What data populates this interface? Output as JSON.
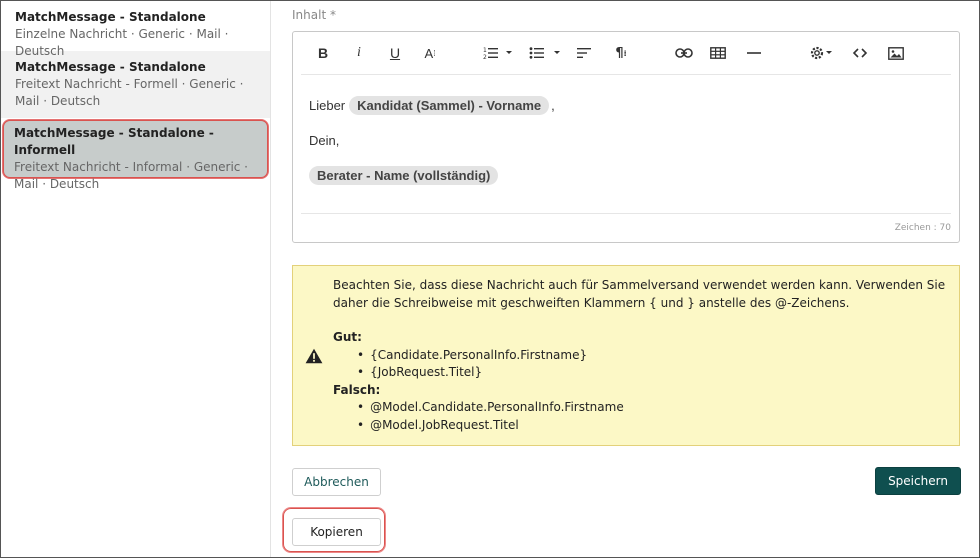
{
  "sidebar": {
    "items": [
      {
        "title": "MatchMessage - Standalone",
        "subtitle": "Einzelne Nachricht · Generic · Mail · Deutsch"
      },
      {
        "title": "MatchMessage - Standalone",
        "subtitle": "Freitext Nachricht - Formell · Generic · Mail · Deutsch"
      },
      {
        "title": "MatchMessage - Standalone - Informell",
        "subtitle": "Freitext Nachricht - Informal · Generic · Mail · Deutsch"
      }
    ]
  },
  "editor": {
    "label": "Inhalt *",
    "toolbar_icons": [
      "bold-icon",
      "italic-icon",
      "underline-icon",
      "font-size-icon",
      "ordered-list-icon",
      "unordered-list-icon",
      "align-icon",
      "paragraph-icon",
      "link-icon",
      "table-icon",
      "horizontal-rule-icon",
      "settings-icon",
      "code-view-icon",
      "image-icon"
    ],
    "content": {
      "greeting": "Lieber",
      "placeholder1": "Kandidat (Sammel) - Vorname",
      "comma": ",",
      "closing": "Dein,",
      "placeholder2": "Berater - Name (vollständig)"
    },
    "char_count": "Zeichen : 70"
  },
  "warning": {
    "text": "Beachten Sie, dass diese Nachricht auch für Sammelversand verwendet werden kann. Verwenden Sie daher die Schreibweise mit geschweiften Klammern { und } anstelle des @-Zeichens.",
    "good_label": "Gut:",
    "good_items": [
      "{Candidate.PersonalInfo.Firstname}",
      "{JobRequest.Titel}"
    ],
    "bad_label": "Falsch:",
    "bad_items": [
      "@Model.Candidate.PersonalInfo.Firstname",
      "@Model.JobRequest.Titel"
    ]
  },
  "buttons": {
    "cancel": "Abbrechen",
    "save": "Speichern",
    "copy": "Kopieren"
  },
  "colors": {
    "primary": "#0f4f4f",
    "warning_bg": "#fcf8c6",
    "highlight": "#d9534f"
  }
}
